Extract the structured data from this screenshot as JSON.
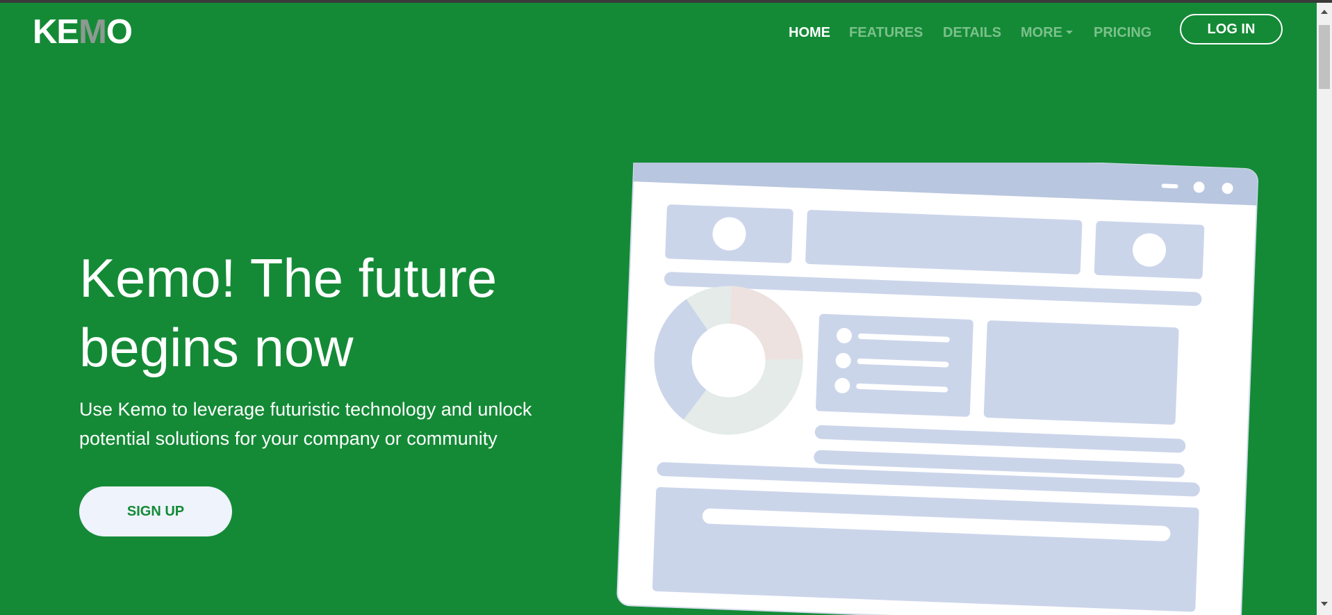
{
  "brand": {
    "logo_part1": "KE",
    "logo_part2": "M",
    "logo_part3": "O"
  },
  "nav": {
    "items": [
      {
        "label": "HOME",
        "active": true
      },
      {
        "label": "FEATURES",
        "active": false
      },
      {
        "label": "DETAILS",
        "active": false
      },
      {
        "label": "MORE",
        "active": false,
        "dropdown": true
      },
      {
        "label": "PRICING",
        "active": false
      }
    ],
    "login_label": "LOG IN"
  },
  "hero": {
    "headline_line1": "Kemo! The future",
    "headline_line2": "begins now",
    "subtext_line1": "Use Kemo to leverage futuristic technology and unlock",
    "subtext_line2": "potential solutions for your company or community",
    "signup_label": "SIGN UP"
  },
  "colors": {
    "background": "#148a36",
    "nav_inactive": "#7bc18b",
    "button_light": "#eef3fc",
    "illustration_panel": "#cbd5ea",
    "illustration_header": "#b8c6df"
  },
  "illustration": {
    "icon": "dashboard-window-illustration",
    "donut_segments": [
      {
        "label": "blue",
        "color": "#cbd5ea",
        "fraction": 0.3
      },
      {
        "label": "pink",
        "color": "#ede2df",
        "fraction": 0.24
      },
      {
        "label": "grey",
        "color": "#e4ebe9",
        "fraction": 0.46
      }
    ]
  }
}
